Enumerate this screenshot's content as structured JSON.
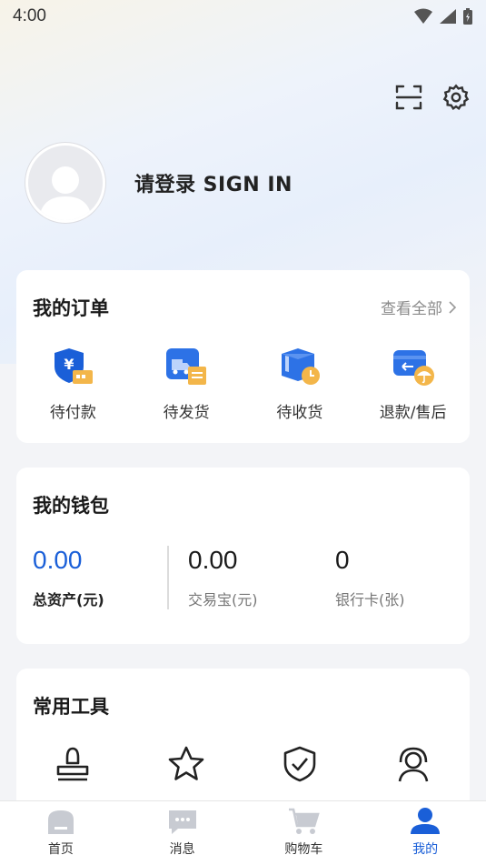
{
  "status_bar": {
    "time": "4:00"
  },
  "profile": {
    "login_text": "请登录 SIGN IN"
  },
  "orders": {
    "title": "我的订单",
    "view_all": "查看全部",
    "items": [
      {
        "label": "待付款",
        "icon": "payment-shield-icon"
      },
      {
        "label": "待发货",
        "icon": "shipping-truck-icon"
      },
      {
        "label": "待收货",
        "icon": "receive-box-clock-icon"
      },
      {
        "label": "退款/售后",
        "icon": "refund-umbrella-icon"
      }
    ]
  },
  "wallet": {
    "title": "我的钱包",
    "columns": [
      {
        "value": "0.00",
        "label": "总资产(元)"
      },
      {
        "value": "0.00",
        "label": "交易宝(元)"
      },
      {
        "value": "0",
        "label": "银行卡(张)"
      }
    ]
  },
  "tools": {
    "title": "常用工具",
    "items": [
      {
        "icon": "stamp-icon"
      },
      {
        "icon": "star-icon"
      },
      {
        "icon": "shield-check-icon"
      },
      {
        "icon": "headset-user-icon"
      }
    ]
  },
  "tabbar": {
    "items": [
      {
        "label": "首页",
        "icon": "home-icon"
      },
      {
        "label": "消息",
        "icon": "message-icon"
      },
      {
        "label": "购物车",
        "icon": "cart-icon"
      },
      {
        "label": "我的",
        "icon": "user-icon",
        "active": true
      }
    ]
  },
  "colors": {
    "accent": "#1a5fd8",
    "inactive_icon": "#c8cbd2"
  }
}
